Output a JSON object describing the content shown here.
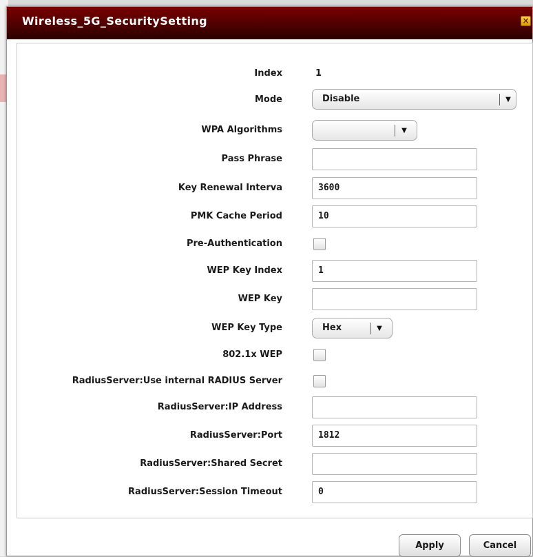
{
  "dialog": {
    "title": "Wireless_5G_SecuritySetting",
    "close_icon": "close-icon"
  },
  "form": {
    "index": {
      "label": "Index",
      "value": "1"
    },
    "mode": {
      "label": "Mode",
      "value": "Disable"
    },
    "wpa_algorithms": {
      "label": "WPA Algorithms",
      "value": ""
    },
    "pass_phrase": {
      "label": "Pass Phrase",
      "value": ""
    },
    "key_renewal": {
      "label": "Key Renewal Interva",
      "value": "3600"
    },
    "pmk_cache": {
      "label": "PMK Cache Period",
      "value": "10"
    },
    "pre_auth": {
      "label": "Pre-Authentication",
      "checked": false
    },
    "wep_key_index": {
      "label": "WEP Key Index",
      "value": "1"
    },
    "wep_key": {
      "label": "WEP Key",
      "value": ""
    },
    "wep_key_type": {
      "label": "WEP Key Type",
      "value": "Hex"
    },
    "wep_8021x": {
      "label": "802.1x WEP",
      "checked": false
    },
    "radius_internal": {
      "label": "RadiusServer:Use internal RADIUS Server",
      "checked": false
    },
    "radius_ip": {
      "label": "RadiusServer:IP Address",
      "value": ""
    },
    "radius_port": {
      "label": "RadiusServer:Port",
      "value": "1812"
    },
    "radius_secret": {
      "label": "RadiusServer:Shared Secret",
      "value": ""
    },
    "radius_timeout": {
      "label": "RadiusServer:Session Timeout",
      "value": "0"
    }
  },
  "buttons": {
    "apply": "Apply",
    "cancel": "Cancel"
  },
  "colors": {
    "titlebar": "#560000",
    "title_text": "#ffffff",
    "close_button": "#f0b400"
  }
}
